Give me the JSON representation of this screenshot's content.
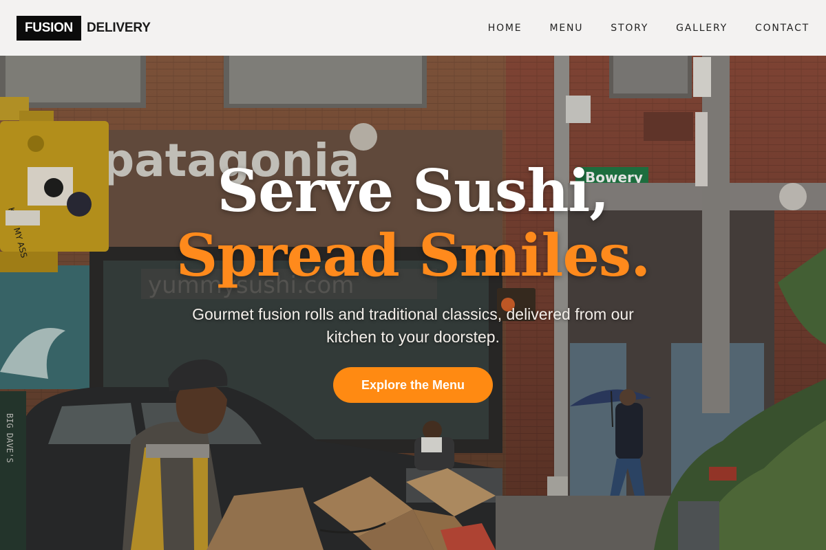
{
  "brand": {
    "box_label": "FUSION",
    "name": "DELIVERY"
  },
  "nav": {
    "items": [
      "HOME",
      "MENU",
      "STORY",
      "GALLERY",
      "CONTACT"
    ]
  },
  "hero": {
    "title_line1": "Serve Sushi,",
    "title_line2": "Spread Smiles.",
    "subtitle": "Gourmet fusion rolls and traditional classics, delivered from our kitchen to your doorstep.",
    "cta_label": "Explore the Menu"
  },
  "photo": {
    "store_sign": "patagonia",
    "street_sign": "Bowery",
    "window_text": "yummysushi.com",
    "sticker_text": "KISS MY ASS",
    "box_text": "BIG DAVE'S"
  },
  "colors": {
    "accent": "#ff8a12",
    "header_bg": "#f3f2f1",
    "logo_box": "#0b0b0b"
  }
}
